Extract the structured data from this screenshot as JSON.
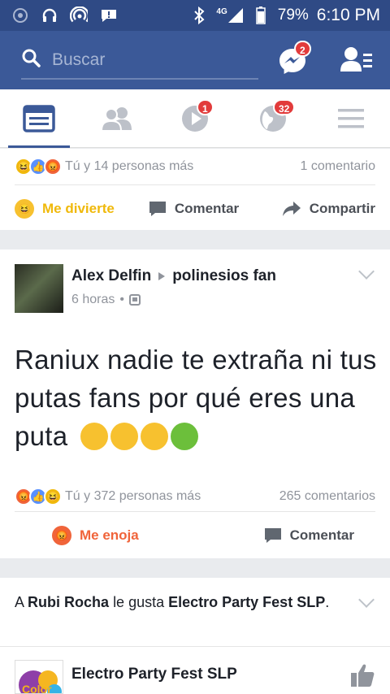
{
  "status": {
    "network": "4G",
    "battery": "79%",
    "time": "6:10 PM"
  },
  "search": {
    "placeholder": "Buscar"
  },
  "header_badges": {
    "messenger": "2"
  },
  "tabs": [
    {
      "name": "feed",
      "icon": "news-feed-icon",
      "badge": ""
    },
    {
      "name": "friends",
      "icon": "friends-icon",
      "badge": ""
    },
    {
      "name": "video",
      "icon": "video-icon",
      "badge": "1"
    },
    {
      "name": "notifications",
      "icon": "globe-icon",
      "badge": "32"
    },
    {
      "name": "menu",
      "icon": "hamburger-icon",
      "badge": ""
    }
  ],
  "post1": {
    "reactions_text": "Tú y 14 personas más",
    "comments": "1 comentario",
    "my_reaction": "Me divierte",
    "comment_label": "Comentar",
    "share_label": "Compartir"
  },
  "post2": {
    "author": "Alex Delfin",
    "group": "polinesios fan",
    "time": "6 horas",
    "text": "Raniux nadie te extraña ni tus putas fans por qué eres una puta",
    "reactions_text": "Tú y 372 personas más",
    "comments": "265 comentarios",
    "my_reaction": "Me enoja",
    "comment_label": "Comentar"
  },
  "post3": {
    "prefix": "A",
    "friend": "Rubi Rocha",
    "middle": "le gusta",
    "page": "Electro Party Fest SLP",
    "suffix": ".",
    "page_title": "Electro Party Fest SLP"
  },
  "colors": {
    "brand": "#3b5998",
    "status_bar": "#2f4a85",
    "haha": "#f0b90b",
    "angry": "#f0643a"
  }
}
